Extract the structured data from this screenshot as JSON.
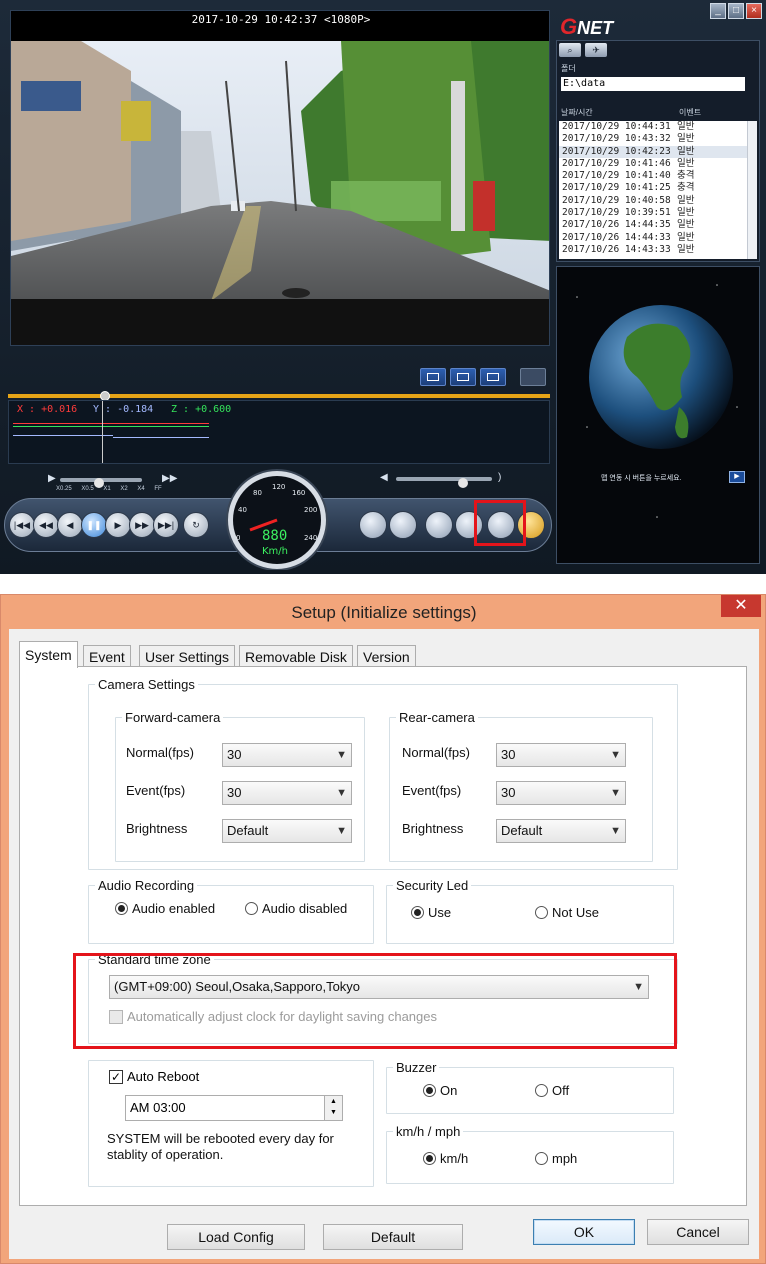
{
  "player": {
    "video_header": "2017-10-29 10:42:37 <1080P>",
    "gsensor": {
      "x": "X : +0.016",
      "y": "Y : -0.184",
      "z": "Z : +0.600"
    },
    "speed_labels": "X0.25 X0.5 X1 X2 X4 FF",
    "speedometer": {
      "ticks": [
        "0",
        "40",
        "80",
        "120",
        "160",
        "200",
        "240"
      ],
      "digits": "880",
      "unit": "Km/h"
    },
    "logo": {
      "g": "G",
      "rest": "NET"
    },
    "window_buttons": [
      "_",
      "□",
      "×"
    ],
    "folder": {
      "label": "폴더",
      "path": "E:\\data"
    },
    "list_headers": {
      "datetime": "날짜/시간",
      "event": "이벤트"
    },
    "files": [
      {
        "dt": "2017/10/29 10:44:31",
        "type": "일반"
      },
      {
        "dt": "2017/10/29 10:43:32",
        "type": "일반"
      },
      {
        "dt": "2017/10/29 10:42:23",
        "type": "일반"
      },
      {
        "dt": "2017/10/29 10:41:46",
        "type": "일반"
      },
      {
        "dt": "2017/10/29 10:41:40",
        "type": "충격"
      },
      {
        "dt": "2017/10/29 10:41:25",
        "type": "충격"
      },
      {
        "dt": "2017/10/29 10:40:58",
        "type": "일반"
      },
      {
        "dt": "2017/10/29 10:39:51",
        "type": "일반"
      },
      {
        "dt": "2017/10/26 14:44:35",
        "type": "일반"
      },
      {
        "dt": "2017/10/26 14:44:33",
        "type": "일반"
      },
      {
        "dt": "2017/10/26 14:43:33",
        "type": "일반"
      }
    ],
    "selected_file_index": 2,
    "map_message": "맵 연동 시 버튼을 누르세요.",
    "icons": [
      "zoom-icon",
      "gps-icon",
      "settings-gear-icon",
      "folder-open-icon",
      "film-icon",
      "print-icon",
      "save-icon",
      "volume-icon"
    ],
    "highlight_color": "#e4141b"
  },
  "dialog": {
    "title": "Setup (Initialize settings)",
    "close": "✕",
    "tabs": [
      "System",
      "Event",
      "User Settings",
      "Removable Disk",
      "Version"
    ],
    "active_tab": "System",
    "camera_settings": {
      "legend": "Camera Settings",
      "forward": {
        "legend": "Forward-camera",
        "normal_label": "Normal(fps)",
        "normal_value": "30",
        "event_label": "Event(fps)",
        "event_value": "30",
        "brightness_label": "Brightness",
        "brightness_value": "Default"
      },
      "rear": {
        "legend": "Rear-camera",
        "normal_label": "Normal(fps)",
        "normal_value": "30",
        "event_label": "Event(fps)",
        "event_value": "30",
        "brightness_label": "Brightness",
        "brightness_value": "Default"
      }
    },
    "audio": {
      "legend": "Audio Recording",
      "enabled": "Audio enabled",
      "disabled": "Audio disabled",
      "selected": "enabled"
    },
    "security_led": {
      "legend": "Security Led",
      "use": "Use",
      "not_use": "Not Use",
      "selected": "use"
    },
    "timezone": {
      "legend": "Standard time zone",
      "value": "(GMT+09:00) Seoul,Osaka,Sapporo,Tokyo",
      "dst_label": "Automatically adjust clock for daylight saving changes",
      "dst_checked": false
    },
    "auto_reboot": {
      "label": "Auto Reboot",
      "checked": true,
      "time": "AM  03:00",
      "note_line1": "SYSTEM will be rebooted every day for",
      "note_line2": "stablity of operation."
    },
    "buzzer": {
      "legend": "Buzzer",
      "on": "On",
      "off": "Off",
      "selected": "on"
    },
    "speed_unit": {
      "legend": "km/h / mph",
      "kmh": "km/h",
      "mph": "mph",
      "selected": "kmh"
    },
    "buttons": {
      "load_config": "Load Config",
      "default": "Default",
      "ok": "OK",
      "cancel": "Cancel"
    }
  }
}
